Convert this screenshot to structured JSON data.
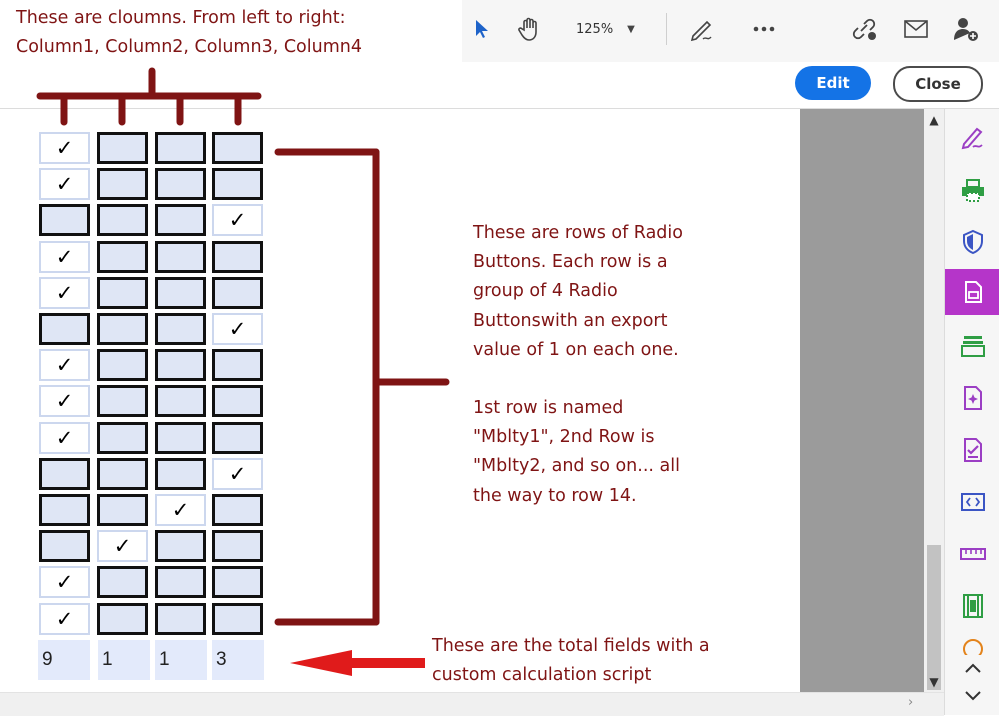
{
  "toolbar": {
    "zoom_value": "125%",
    "icons": [
      "select-arrow-icon",
      "hand-icon",
      "zoom-dropdown",
      "sign-icon",
      "more-icon",
      "link-icon",
      "mail-icon",
      "add-user-icon"
    ]
  },
  "actions": {
    "edit_label": "Edit",
    "close_label": "Close"
  },
  "annotations": {
    "columns_line1": "These are cloumns. From left to right:",
    "columns_line2": "Column1, Column2, Column3, Column4",
    "rows_lines": [
      "These are rows of Radio",
      "Buttons. Each row is a",
      "group of 4 Radio",
      "Buttonswith an export",
      "value of 1 on each one."
    ],
    "naming_lines": [
      "1st row is named",
      "\"Mblty1\", 2nd Row is",
      "\"Mblty2, and so on... all",
      "the way to row 14."
    ],
    "totals_lines": [
      "These are the total fields with a",
      "custom calculation script"
    ]
  },
  "form": {
    "check_mark": "✓",
    "rows_selected_column": [
      1,
      1,
      4,
      1,
      1,
      4,
      1,
      1,
      1,
      4,
      3,
      2,
      1,
      1
    ],
    "totals": [
      "9",
      "1",
      "1",
      "3"
    ]
  },
  "colors": {
    "annotation": "#7f1414",
    "accent_blue": "#1473e6",
    "rail_active": "#b535c9",
    "field_fill": "#dfe6f5"
  },
  "rail_icons": [
    "fill-sign-icon",
    "print-production-icon",
    "protect-icon",
    "active-doc-icon",
    "stamp-icon",
    "create-pdf-icon",
    "form-check-icon",
    "bracket-icon",
    "measure-icon",
    "film-icon",
    "badge-icon"
  ],
  "rail_arrows": [
    "chevron-up-icon",
    "chevron-down-icon"
  ]
}
